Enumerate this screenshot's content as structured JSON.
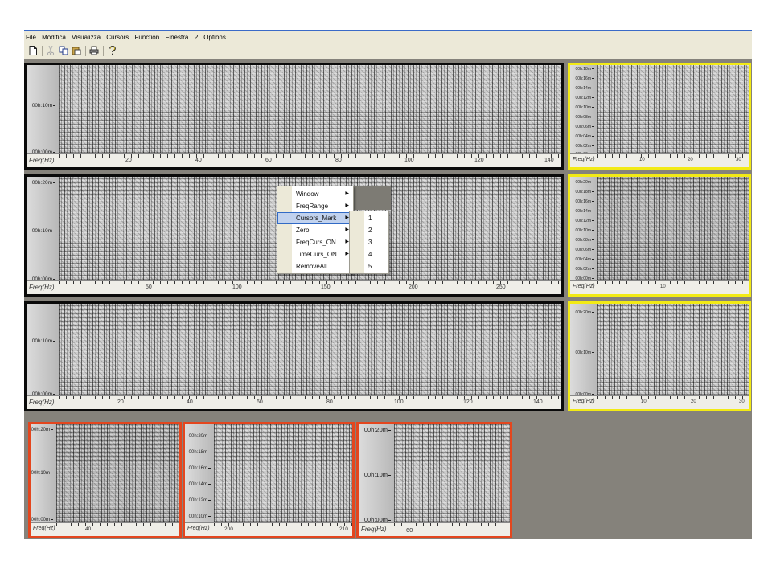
{
  "menubar": [
    "File",
    "Modifica",
    "Visualizza",
    "Cursors",
    "Function",
    "Finestra",
    "?",
    "Options"
  ],
  "toolbar_icons": [
    "new-doc-icon",
    "cut-icon",
    "copy-icon",
    "paste-icon",
    "print-icon",
    "help-icon"
  ],
  "panels": {
    "p1": {
      "y": [
        "00h:10m",
        "00h:00m"
      ],
      "freq": "Freq(Hz)",
      "x": [
        "20",
        "40",
        "60",
        "80",
        "100",
        "120",
        "140"
      ]
    },
    "p2": {
      "y": [
        "00h:20m",
        "00h:10m",
        "00h:00m"
      ],
      "freq": "Freq(Hz)",
      "x": [
        "50",
        "100",
        "150",
        "200",
        "250"
      ]
    },
    "p3": {
      "y": [
        "00h:10m",
        "00h:00m"
      ],
      "freq": "Freq(Hz)",
      "x": [
        "20",
        "40",
        "60",
        "80",
        "100",
        "120",
        "140"
      ]
    },
    "y1": {
      "y": [
        "00h:18m",
        "00h:16m",
        "00h:14m",
        "00h:12m",
        "00h:10m",
        "00h:08m",
        "00h:06m",
        "00h:04m",
        "00h:02m",
        "00h:00m"
      ],
      "freq": "Freq(Hz)",
      "x": [
        "10",
        "20",
        "30"
      ]
    },
    "y2": {
      "y": [
        "00h:20m",
        "00h:18m",
        "00h:16m",
        "00h:14m",
        "00h:12m",
        "00h:10m",
        "00h:08m",
        "00h:06m",
        "00h:04m",
        "00h:02m",
        "00h:00m"
      ],
      "freq": "Freq(Hz)",
      "x": [
        "10"
      ]
    },
    "y3": {
      "y": [
        "00h:20m",
        "00h:10m",
        "00h:00m"
      ],
      "freq": "Freq(Hz)",
      "x": [
        "10",
        "20",
        "30"
      ]
    },
    "r1": {
      "y": [
        "00h:20m",
        "00h:10m",
        "00h:00m"
      ],
      "freq": "Freq(Hz)",
      "x": [
        "40"
      ]
    },
    "r2": {
      "y": [
        "00h:20m",
        "00h:18m",
        "00h:16m",
        "00h:14m",
        "00h:12m",
        "00h:10m"
      ],
      "freq": "Freq(Hz)",
      "x": [
        "200",
        "210"
      ]
    },
    "r3": {
      "y": [
        "00h:20m",
        "00h:10m",
        "00h:00m"
      ],
      "freq": "Freq(Hz)",
      "x": [
        "60"
      ]
    }
  },
  "context_menu": {
    "items": [
      "Window",
      "FreqRange",
      "Cursors_Mark",
      "Zero",
      "FreqCurs_ON",
      "TimeCurs_ON",
      "RemoveAll"
    ],
    "selected": "Cursors_Mark",
    "submenu": [
      "1",
      "2",
      "3",
      "4",
      "5"
    ]
  },
  "colors": {
    "active_border": "#0a0a0a",
    "yellow_border": "#f2ea15",
    "red_border": "#e4461e",
    "workspace": "#85827b"
  }
}
